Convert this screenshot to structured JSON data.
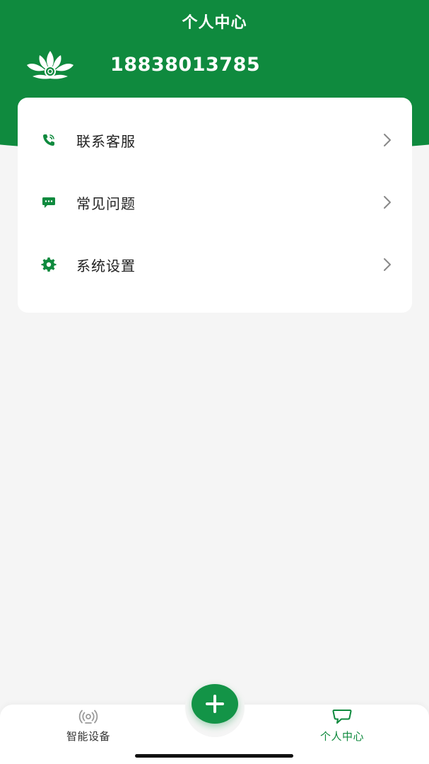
{
  "header": {
    "title": "个人中心",
    "phone_number": "18838013785"
  },
  "menu": {
    "items": [
      {
        "label": "联系客服",
        "icon": "phone-icon"
      },
      {
        "label": "常见问题",
        "icon": "message-icon"
      },
      {
        "label": "系统设置",
        "icon": "gear-icon"
      }
    ]
  },
  "tabbar": {
    "devices_label": "智能设备",
    "devices_icon": "smart-device-icon",
    "profile_label": "个人中心",
    "profile_icon": "chat-bubble-icon",
    "add_icon": "plus-icon"
  },
  "colors": {
    "brand_green": "#0f8a3e",
    "fab_green": "#139447",
    "background": "#f5f5f5",
    "card": "#ffffff"
  }
}
